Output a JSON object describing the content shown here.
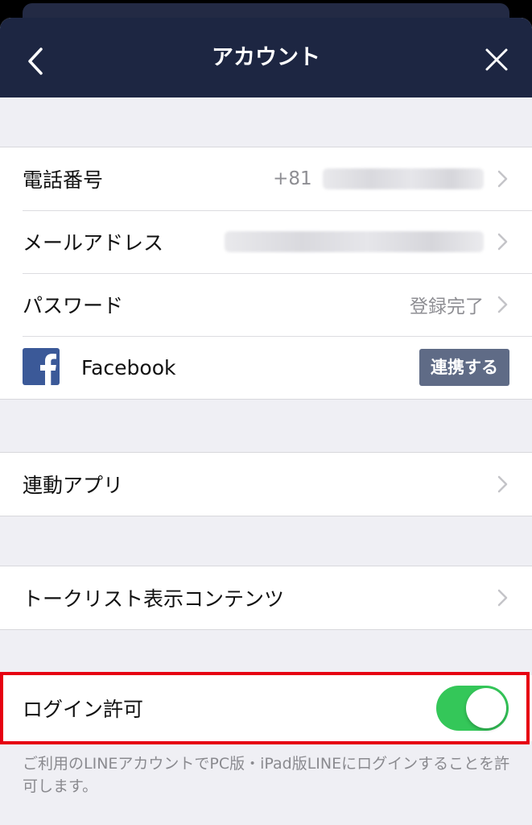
{
  "header": {
    "title": "アカウント",
    "back_icon": "chevron-left-icon",
    "close_icon": "close-icon"
  },
  "account": {
    "phone": {
      "label": "電話番号",
      "value_prefix": "+81"
    },
    "email": {
      "label": "メールアドレス"
    },
    "password": {
      "label": "パスワード",
      "value": "登録完了"
    },
    "facebook": {
      "label": "Facebook",
      "button": "連携する"
    }
  },
  "linked_apps": {
    "label": "連動アプリ"
  },
  "talk_list": {
    "label": "トークリスト表示コンテンツ"
  },
  "login_permission": {
    "label": "ログイン許可",
    "enabled": true,
    "description": "ご利用のLINEアカウントでPC版・iPad版LINEにログインすることを許可します。"
  },
  "colors": {
    "header_bg": "#1d2642",
    "toggle_on": "#34c759",
    "highlight": "#e60012",
    "facebook_blue": "#3b5998",
    "link_button": "#5f6b86"
  }
}
